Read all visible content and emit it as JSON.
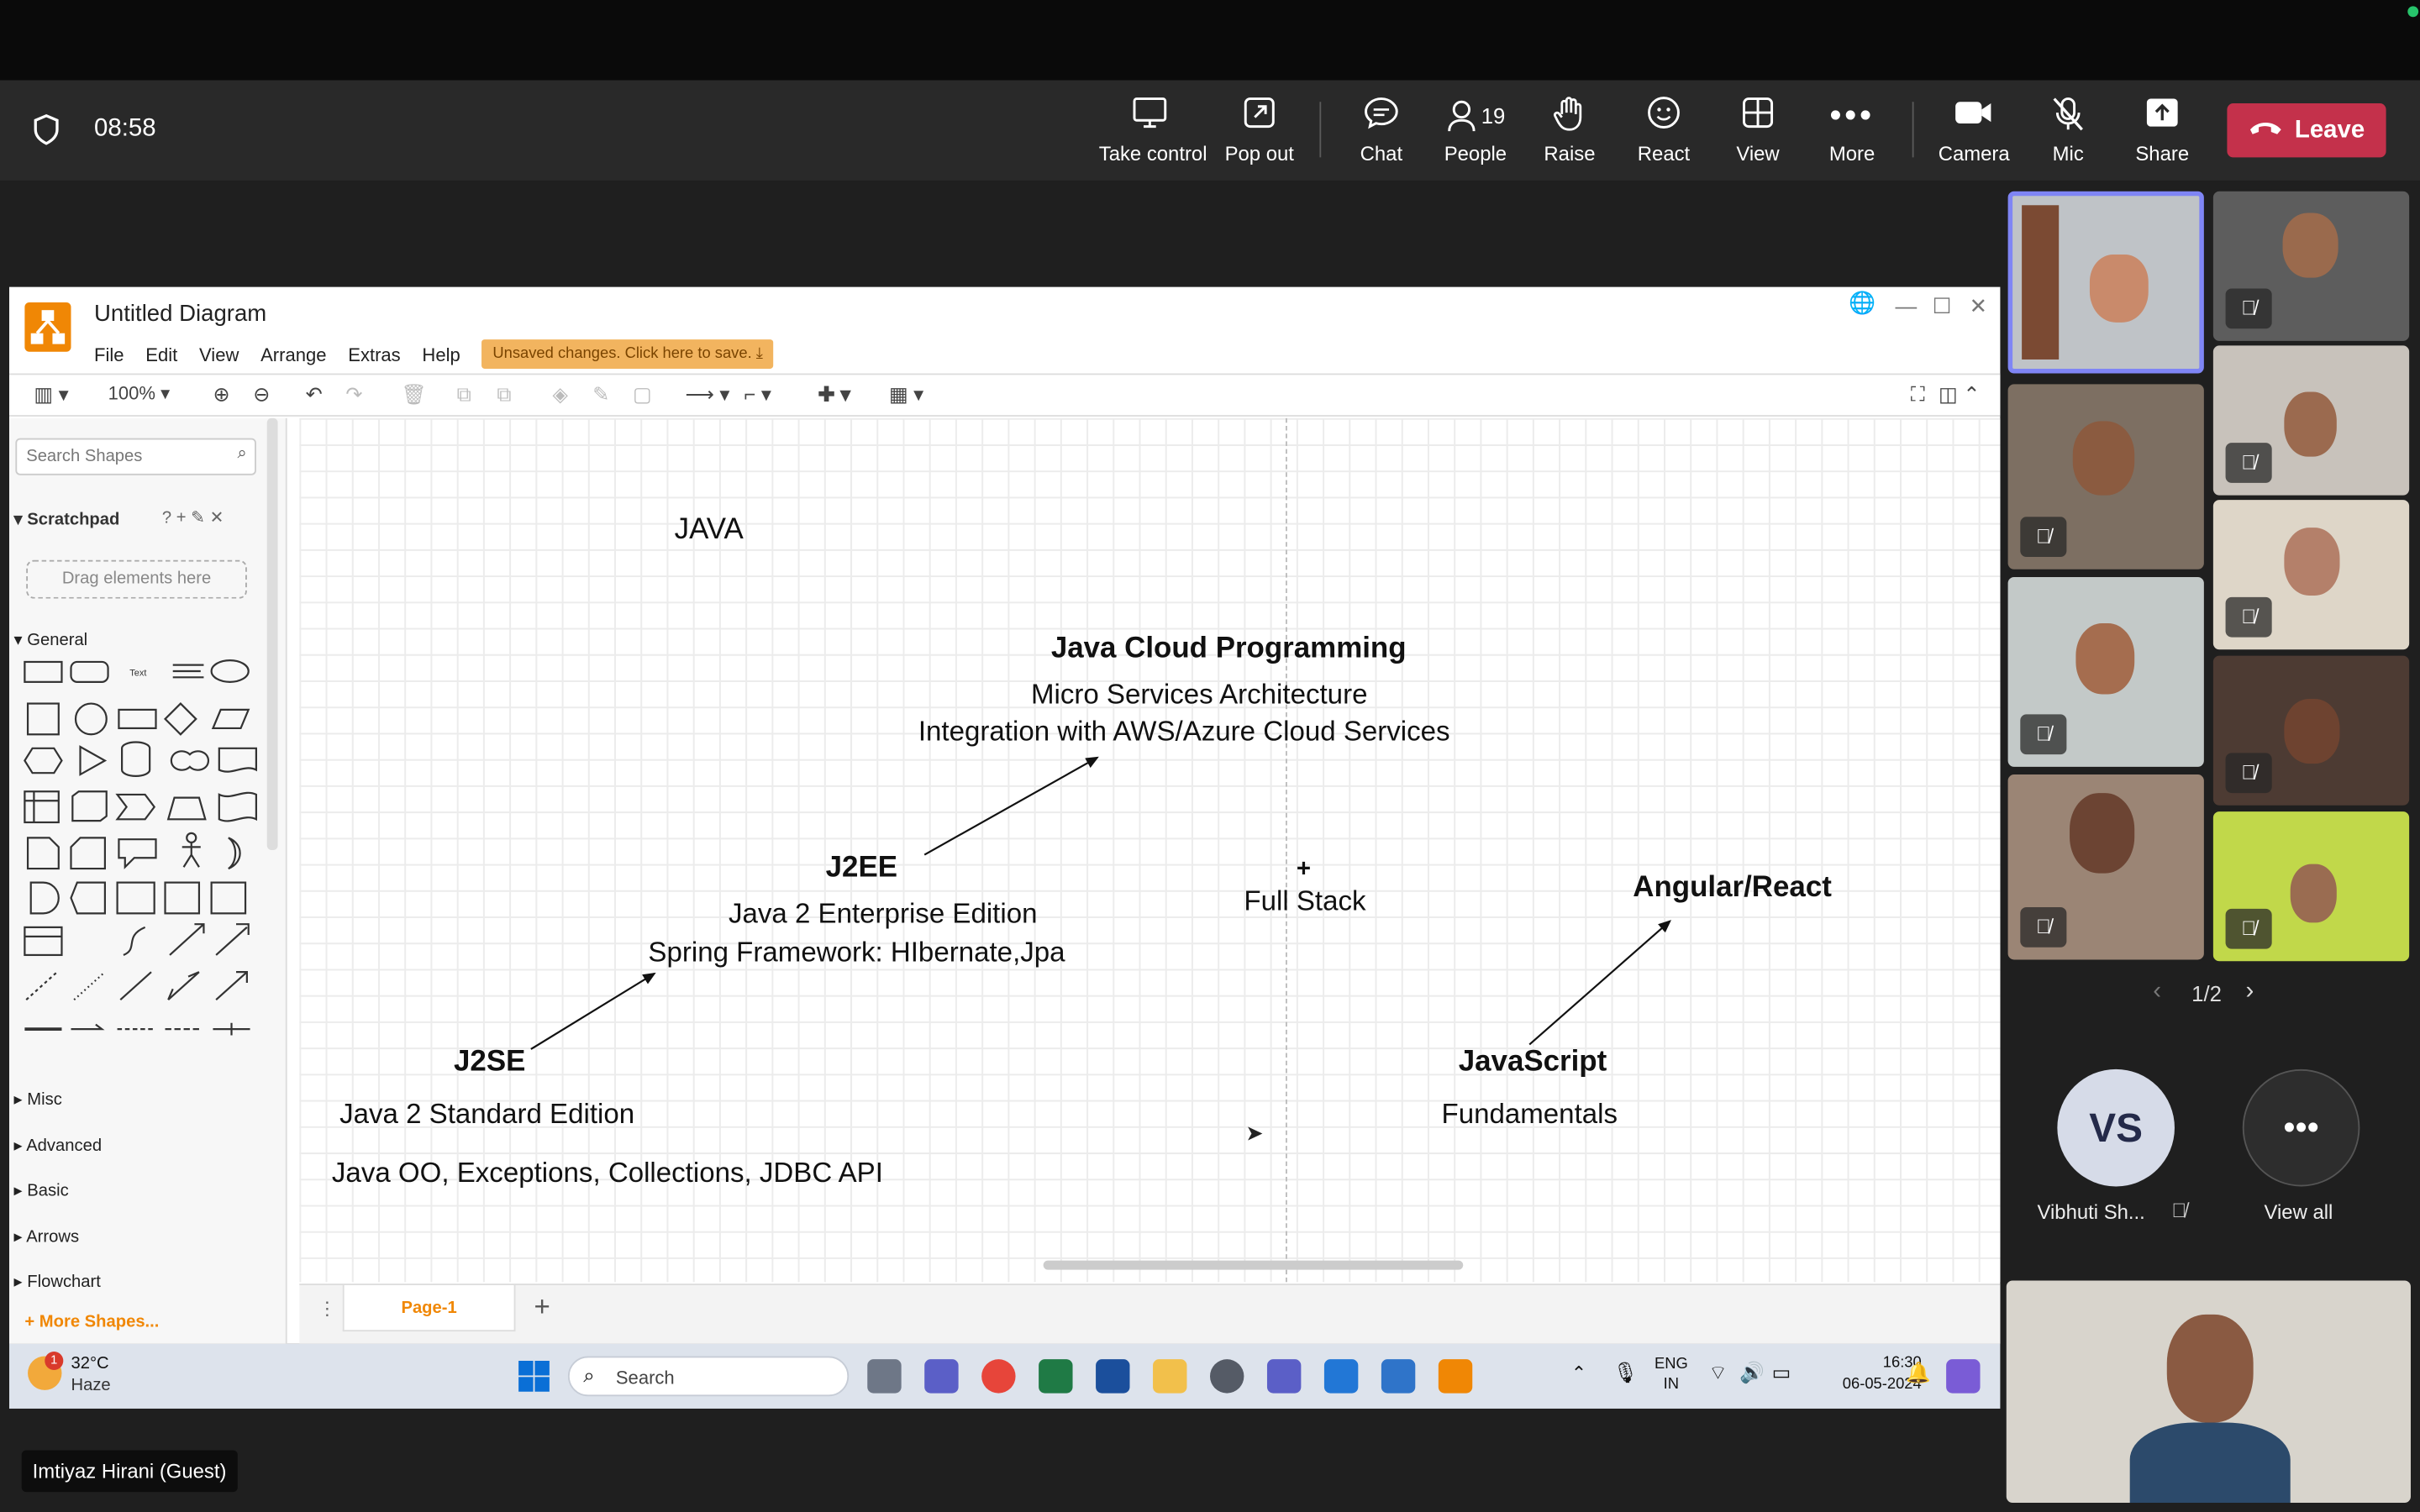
{
  "meeting": {
    "time": "08:58",
    "buttons": {
      "take_control": "Take control",
      "pop_out": "Pop out",
      "chat": "Chat",
      "people": "People",
      "people_count": "19",
      "raise": "Raise",
      "react": "React",
      "view": "View",
      "more": "More",
      "camera": "Camera",
      "mic": "Mic",
      "share": "Share",
      "leave": "Leave"
    },
    "gallery_page": "1/2",
    "participant_initials": "VS",
    "participant_name": "Vibhuti Sh...",
    "view_all": "View all",
    "presenter_name": "Imtiyaz Hirani (Guest)",
    "colors": {
      "leave": "#c4314b",
      "accent": "#6264a7"
    }
  },
  "drawio": {
    "title": "Untitled Diagram",
    "menus": [
      "File",
      "Edit",
      "View",
      "Arrange",
      "Extras",
      "Help"
    ],
    "unsaved_notice": "Unsaved changes. Click here to save.",
    "zoom": "100%",
    "search_placeholder": "Search Shapes",
    "scratchpad": "Scratchpad",
    "drag_hint": "Drag elements here",
    "sections": {
      "general": "General",
      "misc": "Misc",
      "advanced": "Advanced",
      "basic": "Basic",
      "arrows": "Arrows",
      "flowchart": "Flowchart"
    },
    "more_shapes": "+ More Shapes...",
    "page_tab": "Page-1",
    "canvas": {
      "java": "JAVA",
      "cloud_title": "Java Cloud Programming",
      "cloud_line1": "Micro Services Architecture",
      "cloud_line2": "Integration with AWS/Azure Cloud Services",
      "j2ee": "J2EE",
      "j2ee_line1": "Java 2 Enterprise Edition",
      "j2ee_line2": "Spring Framework: HIbernate,Jpa",
      "plus": "+",
      "full_stack": "Full Stack",
      "angular": "Angular/React",
      "j2se": "J2SE",
      "j2se_line1": "Java 2 Standard Edition",
      "j2se_line2": "Java OO, Exceptions, Collections, JDBC API",
      "javascript": "JavaScript",
      "fundamentals": "Fundamentals"
    }
  },
  "taskbar": {
    "temperature": "32°C",
    "weather": "Haze",
    "search": "Search",
    "language": "ENG",
    "region": "IN",
    "clock_time": "16:30",
    "clock_date": "06-05-2024",
    "weather_badge": "1"
  }
}
